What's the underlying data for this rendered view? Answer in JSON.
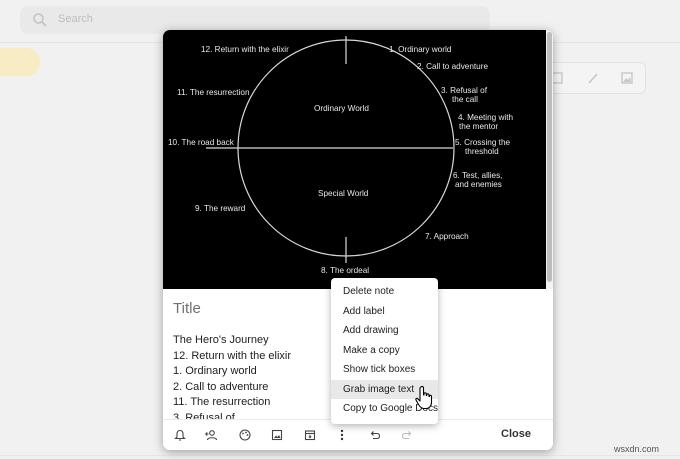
{
  "search": {
    "placeholder": "Search"
  },
  "diagram": {
    "labels": {
      "ordinary_world": "1. Ordinary world",
      "call_to_adventure": "2. Call to adventure",
      "refusal_line1": "3. Refusal of",
      "refusal_line2": "the call",
      "mentor_line1": "4. Meeting with",
      "mentor_line2": "the mentor",
      "threshold_line1": "5. Crossing the",
      "threshold_line2": "threshold",
      "tests_line1": "6. Test, allies,",
      "tests_line2": "and enemies",
      "approach": "7. Approach",
      "ordeal": "8. The ordeal",
      "reward": "9. The reward",
      "road_back": "10. The road back",
      "resurrection": "11. The resurrection",
      "return": "12. Return with the elixir",
      "top_half": "Ordinary World",
      "bottom_half": "Special World"
    }
  },
  "note": {
    "title_placeholder": "Title",
    "lines": [
      "The Hero's Journey",
      "12. Return with the elixir",
      "1. Ordinary world",
      "2. Call to adventure",
      "11. The resurrection",
      "3. Refusal of"
    ]
  },
  "toolbar": {
    "close_label": "Close",
    "icons": [
      "bell-plus-icon",
      "person-add-icon",
      "palette-icon",
      "image-icon",
      "archive-icon",
      "more-vert-icon",
      "undo-icon",
      "redo-icon"
    ]
  },
  "context_menu": {
    "items": [
      "Delete note",
      "Add label",
      "Add drawing",
      "Make a copy",
      "Show tick boxes",
      "Grab image text",
      "Copy to Google Docs"
    ],
    "hovered": "Grab image text"
  },
  "watermark": "wsxdn.com"
}
